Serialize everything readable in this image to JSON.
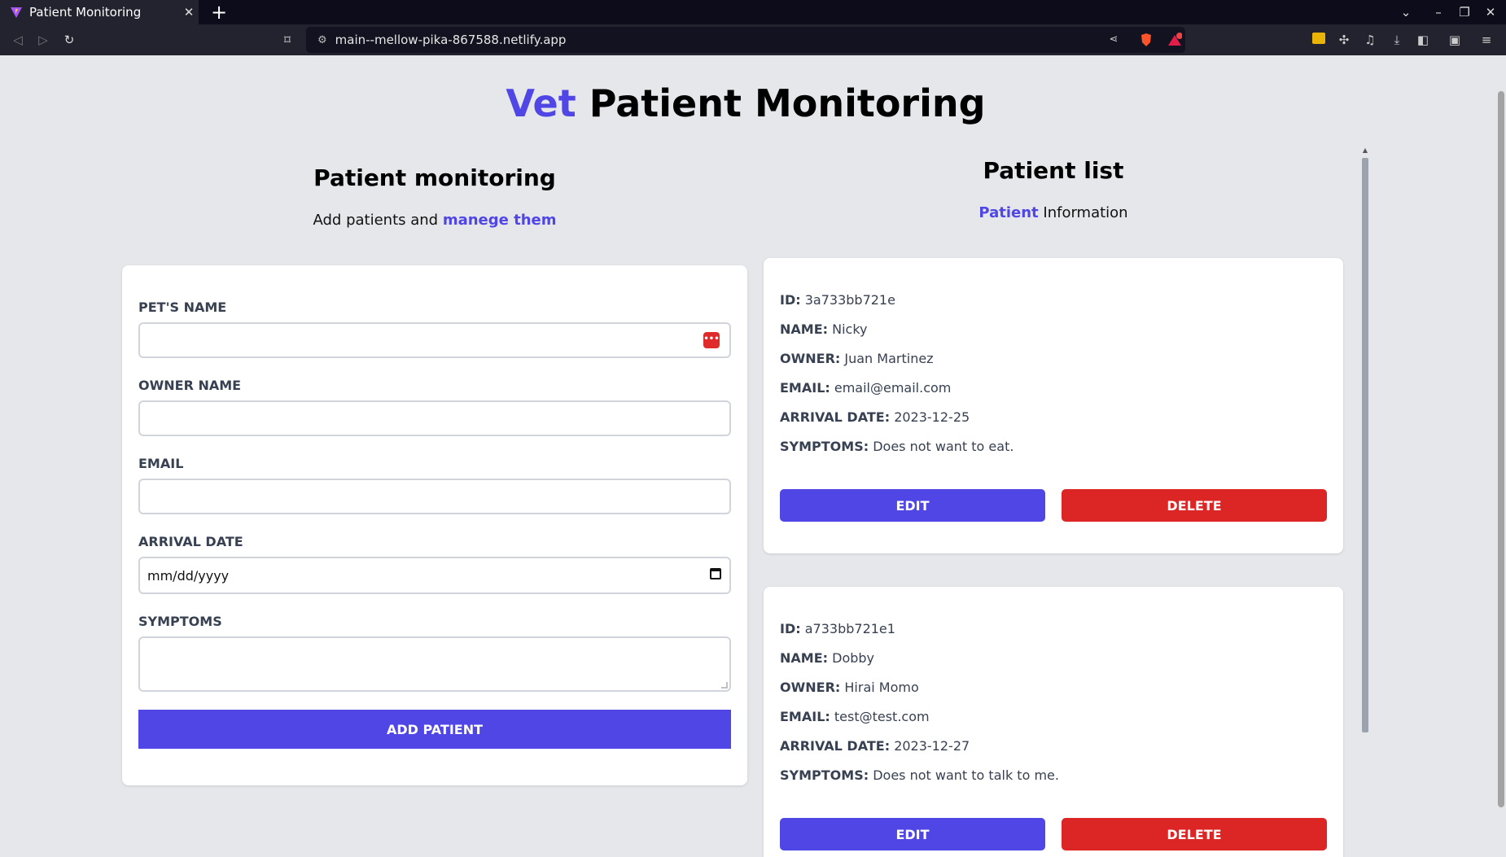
{
  "browser": {
    "tab_title": "Patient Monitoring",
    "url": "main--mellow-pika-867588.netlify.app",
    "tab_close": "✕",
    "new_tab": "+"
  },
  "header": {
    "title_accent": "Vet",
    "title_rest": " Patient Monitoring"
  },
  "form_section": {
    "title": "Patient monitoring",
    "subtitle_plain": "Add patients and ",
    "subtitle_accent": "manege them",
    "fields": {
      "pet_name": {
        "label": "Pet's Name",
        "value": ""
      },
      "owner_name": {
        "label": "Owner Name",
        "value": ""
      },
      "email": {
        "label": "Email",
        "value": ""
      },
      "arrival_date": {
        "label": "Arrival Date",
        "value": "mm/dd/yyyy"
      },
      "symptoms": {
        "label": "Symptoms",
        "value": ""
      }
    },
    "submit_label": "Add Patient"
  },
  "list_section": {
    "title": "Patient list",
    "subtitle_accent": "Patient",
    "subtitle_plain": " Information",
    "keys": {
      "id": "ID:",
      "name": "Name:",
      "owner": "Owner:",
      "email": "Email:",
      "arrival": "Arrival Date:",
      "symptoms": "Symptoms:"
    },
    "edit_label": "Edit",
    "delete_label": "Delete",
    "patients": [
      {
        "id": "3a733bb721e",
        "name": "Nicky",
        "owner": "Juan Martinez",
        "email": "email@email.com",
        "arrival": "2023-12-25",
        "symptoms": "Does not want to eat."
      },
      {
        "id": "a733bb721e1",
        "name": "Dobby",
        "owner": "Hirai Momo",
        "email": "test@test.com",
        "arrival": "2023-12-27",
        "symptoms": "Does not want to talk to me."
      }
    ]
  },
  "colors": {
    "accent": "#4f46e5",
    "danger": "#dc2626",
    "page_bg": "#e5e7eb"
  },
  "icons": {
    "favicon": "vite-logo-icon",
    "password_manager": "password-manager-icon",
    "calendar": "calendar-icon"
  }
}
